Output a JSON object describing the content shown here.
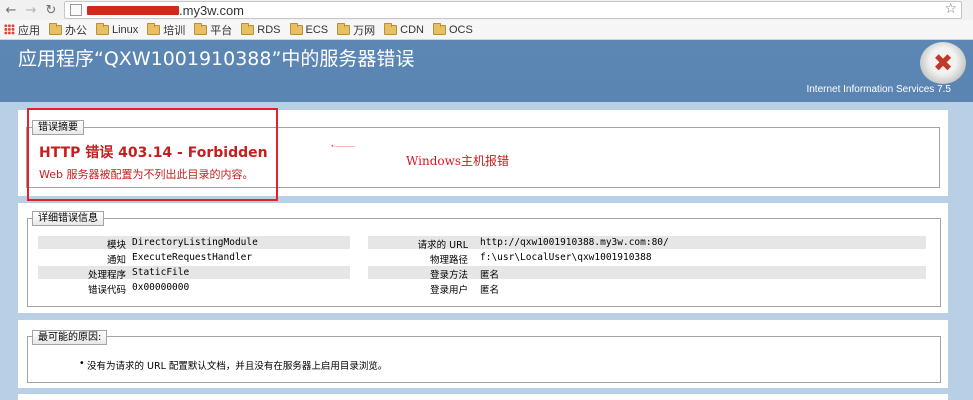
{
  "browser": {
    "url_suffix": ".my3w.com",
    "bookmarks": [
      {
        "label": "应用",
        "kind": "apps"
      },
      {
        "label": "办公",
        "kind": "folder"
      },
      {
        "label": "Linux",
        "kind": "folder"
      },
      {
        "label": "培训",
        "kind": "folder"
      },
      {
        "label": "平台",
        "kind": "folder"
      },
      {
        "label": "RDS",
        "kind": "folder"
      },
      {
        "label": "ECS",
        "kind": "folder"
      },
      {
        "label": "万网",
        "kind": "folder"
      },
      {
        "label": "CDN",
        "kind": "folder"
      },
      {
        "label": "OCS",
        "kind": "folder"
      }
    ],
    "icons": {
      "back": "back-arrow-icon",
      "forward": "forward-arrow-icon",
      "refresh": "refresh-icon",
      "star": "star-icon"
    }
  },
  "header": {
    "title": "应用程序“QXW1001910388”中的服务器错误",
    "version": "Internet Information Services 7.5"
  },
  "summary": {
    "legend": "错误摘要",
    "title": "HTTP 错误 403.14 - Forbidden",
    "description": "Web 服务器被配置为不列出此目录的内容。"
  },
  "annotation": {
    "text": "Windows主机报错",
    "color": "#d2181e"
  },
  "details": {
    "legend": "详细错误信息",
    "left": [
      {
        "label": "模块",
        "value": "DirectoryListingModule"
      },
      {
        "label": "通知",
        "value": "ExecuteRequestHandler"
      },
      {
        "label": "处理程序",
        "value": "StaticFile"
      },
      {
        "label": "错误代码",
        "value": "0x00000000"
      }
    ],
    "right": [
      {
        "label": "请求的 URL",
        "value": "http://qxw1001910388.my3w.com:80/"
      },
      {
        "label": "物理路径",
        "value": "f:\\usr\\LocalUser\\qxw1001910388"
      },
      {
        "label": "登录方法",
        "value": "匿名"
      },
      {
        "label": "登录用户",
        "value": "匿名"
      }
    ]
  },
  "causes": {
    "legend": "最可能的原因:",
    "items": [
      "没有为请求的 URL 配置默认文档，并且没有在服务器上启用目录浏览。"
    ]
  },
  "colors": {
    "header_bg": "#5c86b4",
    "content_bg": "#b9cfe6",
    "error_red": "#c41e1e"
  }
}
